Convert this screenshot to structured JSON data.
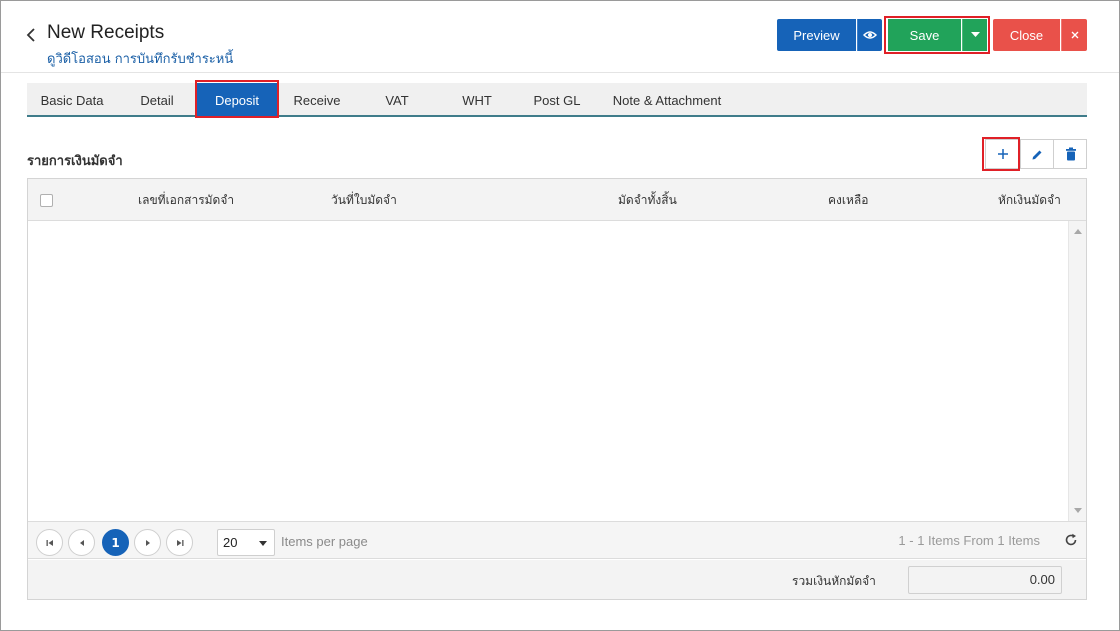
{
  "header": {
    "title": "New Receipts",
    "subtitle": "ดูวิดีโอสอน การบันทึกรับชำระหนี้",
    "buttons": {
      "preview": "Preview",
      "save": "Save",
      "close": "Close"
    }
  },
  "tabs": [
    {
      "label": "Basic Data"
    },
    {
      "label": "Detail"
    },
    {
      "label": "Deposit",
      "active": true
    },
    {
      "label": "Receive"
    },
    {
      "label": "VAT"
    },
    {
      "label": "WHT"
    },
    {
      "label": "Post GL"
    },
    {
      "label": "Note & Attachment"
    }
  ],
  "section": {
    "title": "รายการเงินมัดจำ"
  },
  "table": {
    "columns": [
      "เลขที่เอกสารมัดจำ",
      "วันที่ใบมัดจำ",
      "มัดจำทั้งสิ้น",
      "คงเหลือ",
      "หักเงินมัดจำ"
    ],
    "rows": []
  },
  "pager": {
    "current_page": "1",
    "page_size": "20",
    "items_per_page_label": "Items per page",
    "items_info": "1 - 1 Items From 1 Items"
  },
  "footer": {
    "total_label": "รวมเงินหักมัดจำ",
    "total_value": "0.00"
  },
  "colors": {
    "primary": "#1663b8",
    "save": "#21a35a",
    "close": "#e9514a",
    "highlight": "#e02027"
  }
}
